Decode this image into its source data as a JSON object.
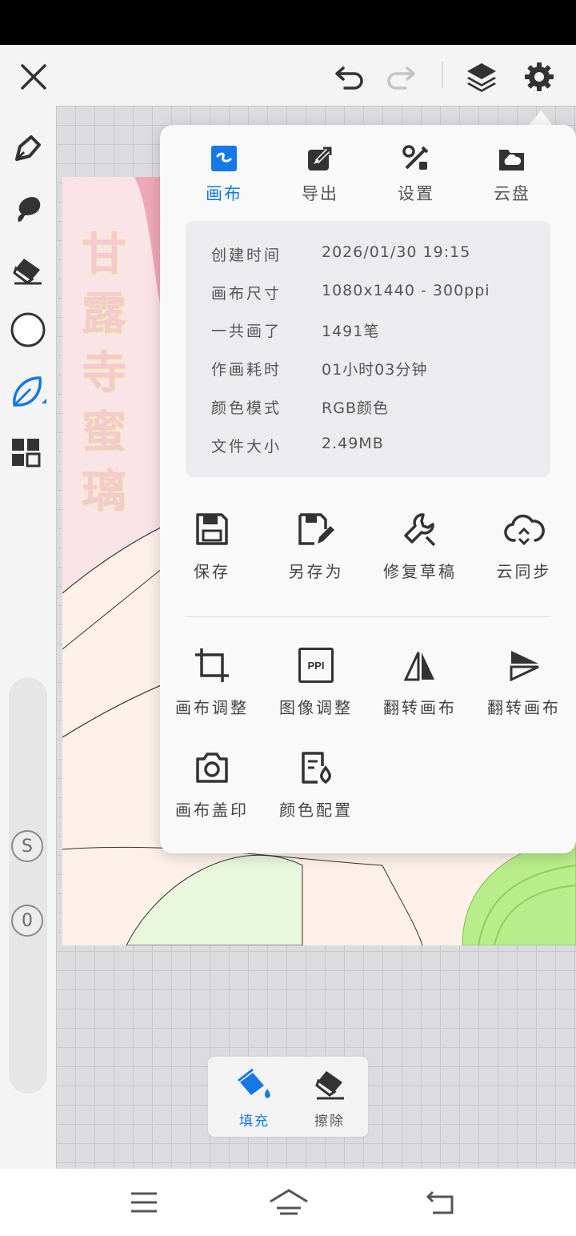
{
  "tabs": [
    {
      "label": "画布",
      "icon": "canvas-icon",
      "active": true
    },
    {
      "label": "导出",
      "icon": "export-icon",
      "active": false
    },
    {
      "label": "设置",
      "icon": "settings-tools-icon",
      "active": false
    },
    {
      "label": "云盘",
      "icon": "cloud-drive-icon",
      "active": false
    }
  ],
  "info": [
    {
      "key": "创建时间",
      "value": "2026/01/30 19:15"
    },
    {
      "key": "画布尺寸",
      "value": "1080x1440 - 300ppi"
    },
    {
      "key": "一共画了",
      "value": "1491笔"
    },
    {
      "key": "作画耗时",
      "value": "01小时03分钟"
    },
    {
      "key": "颜色模式",
      "value": "RGB颜色"
    },
    {
      "key": "文件大小",
      "value": "2.49MB"
    }
  ],
  "actions_row1": [
    {
      "label": "保存",
      "icon": "save-icon"
    },
    {
      "label": "另存为",
      "icon": "save-as-icon"
    },
    {
      "label": "修复草稿",
      "icon": "wrench-icon"
    },
    {
      "label": "云同步",
      "icon": "cloud-sync-icon"
    }
  ],
  "actions_row2": [
    {
      "label": "画布调整",
      "icon": "crop-icon"
    },
    {
      "label": "图像调整",
      "icon": "ppi-icon"
    },
    {
      "label": "翻转画布",
      "icon": "flip-horizontal-icon"
    },
    {
      "label": "翻转画布",
      "icon": "flip-vertical-icon"
    }
  ],
  "actions_row3": [
    {
      "label": "画布盖印",
      "icon": "camera-icon"
    },
    {
      "label": "颜色配置",
      "icon": "color-config-icon"
    }
  ],
  "ppi_badge": "PPI",
  "artwork_title": [
    "甘",
    "露",
    "寺",
    "蜜",
    "璃"
  ],
  "side_badges": {
    "s": "S",
    "o": "0"
  },
  "fill_tools": [
    {
      "label": "填充",
      "icon": "paint-bucket-icon",
      "active": true
    },
    {
      "label": "擦除",
      "icon": "eraser-icon",
      "active": false
    }
  ],
  "colors": {
    "accent": "#1677e8",
    "panel": "#f9f9f9",
    "info_bg": "#ececee"
  }
}
